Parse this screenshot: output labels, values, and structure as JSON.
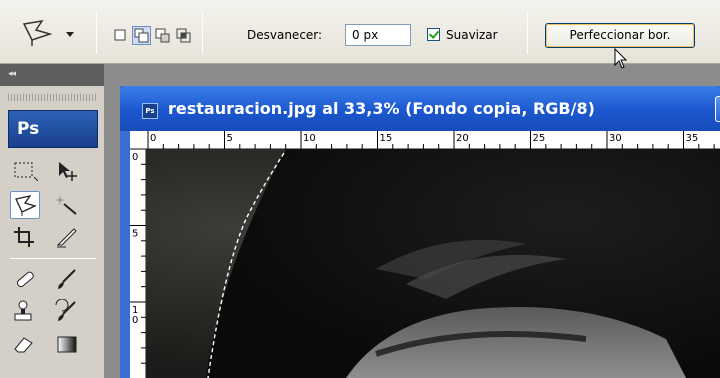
{
  "options_bar": {
    "tool_preset_icon": "polygonal-lasso-icon",
    "selection_modes": [
      "new-selection-icon",
      "add-to-selection-icon",
      "subtract-from-selection-icon",
      "intersect-selection-icon"
    ],
    "feather_label": "Desvanecer:",
    "feather_value": "0 px",
    "antialias_label": "Suavizar",
    "antialias_checked": true,
    "refine_button_label": "Perfeccionar bor."
  },
  "tools_panel": {
    "collapse_glyph": "◂◂",
    "logo_text": "Ps",
    "tools": [
      "marquee-icon",
      "move-icon",
      "polygonal-lasso-icon",
      "magic-wand-icon",
      "crop-icon",
      "slice-icon",
      "healing-brush-icon",
      "brush-icon",
      "clone-stamp-icon",
      "history-brush-icon",
      "eraser-icon",
      "gradient-icon"
    ]
  },
  "document": {
    "title": "restauracion.jpg al 33,3% (Fondo copia, RGB/8)",
    "icon_text": "Ps",
    "hruler_ticks": [
      "0",
      "5",
      "10",
      "15",
      "20",
      "25",
      "30",
      "35"
    ],
    "vruler_ticks": [
      "0",
      "5",
      "1\n0"
    ]
  },
  "colors": {
    "titlebar": "#1b57cf",
    "accent": "#3c7fe9"
  }
}
